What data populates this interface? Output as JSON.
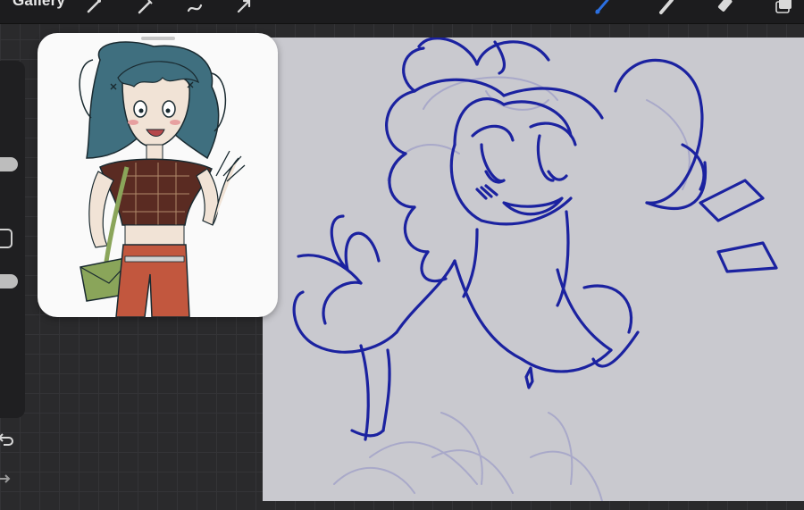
{
  "topbar": {
    "gallery_label": "Gallery",
    "left_tools": [
      "actions-icon",
      "adjustments-icon",
      "selection-icon",
      "transform-icon"
    ],
    "right_tools": [
      "brush-icon",
      "smudge-icon",
      "eraser-icon",
      "layers-icon"
    ],
    "active_tool": "brush-icon",
    "accent_color": "#2b6fe0"
  },
  "sidebar": {
    "controls": [
      "brush-size-slider",
      "modify-button",
      "brush-opacity-slider",
      "undo-icon",
      "redo-icon"
    ]
  },
  "canvas": {
    "background_color": "#c9c9cf",
    "ink_color": "#1b22a0",
    "sketch_color": "#a9a9c9"
  },
  "reference": {
    "window_label": "reference-window",
    "hair_color": "#3f6f7f",
    "shirt_color": "#5a2b22",
    "bag_color": "#8aa55a",
    "pants_color": "#c2573e"
  }
}
